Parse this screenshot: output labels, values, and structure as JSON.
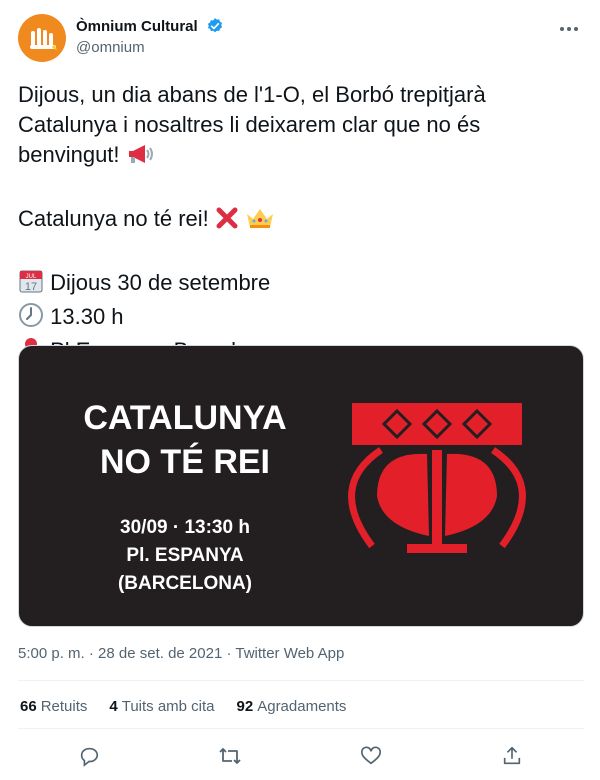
{
  "author": {
    "display_name": "Òmnium Cultural",
    "handle": "@omnium",
    "verified": true,
    "avatar_color": "#f08a1f"
  },
  "tweet": {
    "lines": [
      "Dijous, un dia abans de l'1-O, el Borbó trepitjarà",
      "Catalunya i nosaltres li deixarem clar que no és",
      "benvingut!"
    ],
    "line2": "Catalunya no té rei!",
    "date_line": "Dijous 30 de setembre",
    "time_line": "13.30 h",
    "place_line": "Pl Espanya, Barcelona",
    "calendar_month": "JUL",
    "calendar_day": "17"
  },
  "media": {
    "headline_1": "CATALUNYA",
    "headline_2": "NO TÉ REI",
    "sub_1": "30/09 · 13:30 h",
    "sub_2": "Pl. ESPANYA",
    "sub_3": "(BARCELONA)",
    "background": "#231f20",
    "accent": "#e3202a"
  },
  "meta": {
    "timestamp": "5:00 p. m. · 28 de set. de 2021 · Twitter Web App"
  },
  "stats": {
    "retweets_count": "66",
    "retweets_label": "Retuits",
    "quotes_count": "4",
    "quotes_label": "Tuits amb cita",
    "likes_count": "92",
    "likes_label": "Agradaments"
  },
  "icons": {
    "more": "more-icon",
    "reply": "reply-icon",
    "retweet": "retweet-icon",
    "like": "like-icon",
    "share": "share-icon"
  },
  "colors": {
    "text": "#0f1419",
    "muted": "#536471",
    "verified": "#1d9bf0"
  }
}
